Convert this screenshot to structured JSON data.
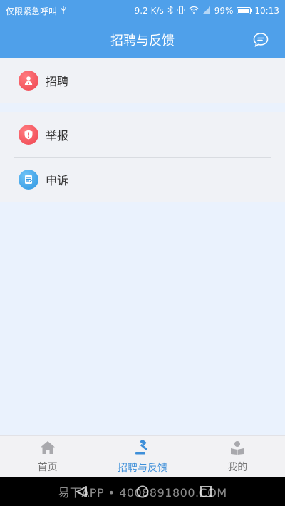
{
  "status_bar": {
    "carrier_text": "仅限紧急呼叫",
    "network_speed": "9.2 K/s",
    "battery": "99%",
    "battery_level": 0.99,
    "time": "10:13"
  },
  "header": {
    "title": "招聘与反馈",
    "chat_icon": "chat-bubble-icon"
  },
  "sections": [
    {
      "items": [
        {
          "label": "招聘",
          "icon": "recruit-user-icon",
          "color": "#f2545b"
        }
      ]
    },
    {
      "items": [
        {
          "label": "举报",
          "icon": "report-shield-icon",
          "color": "#f2545b"
        },
        {
          "label": "申诉",
          "icon": "appeal-document-icon",
          "color": "#3aa3e8"
        }
      ]
    }
  ],
  "tabbar": {
    "tabs": [
      {
        "label": "首页",
        "icon": "home-icon",
        "active": false
      },
      {
        "label": "招聘与反馈",
        "icon": "gavel-icon",
        "active": true
      },
      {
        "label": "我的",
        "icon": "profile-reading-icon",
        "active": false
      }
    ]
  },
  "system_nav": {
    "watermark": "易下APP • 4008891800.COM"
  },
  "colors": {
    "primary": "#4fa0ea",
    "active_tab": "#3d8fd9",
    "background": "#eaf2fd"
  }
}
